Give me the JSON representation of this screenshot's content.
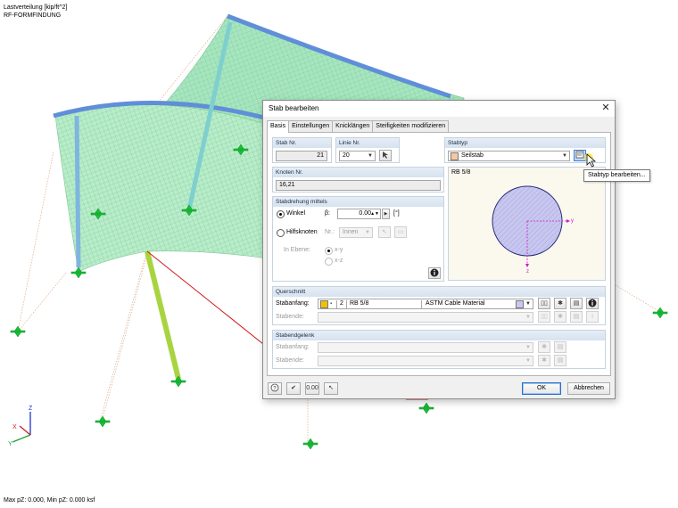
{
  "viewport": {
    "title_line1": "Lastverteilung [kip/ft^2]",
    "title_line2": "RF-FORMFINDUNG",
    "status": "Max pZ: 0.000, Min pZ: 0.000 ksf",
    "axis_z": "Z",
    "axis_x": "X",
    "axis_y": "Y"
  },
  "dialog": {
    "title": "Stab bearbeiten",
    "close_glyph": "✕",
    "tabs": [
      "Basis",
      "Einstellungen",
      "Knicklängen",
      "Steifigkeiten modifizieren"
    ],
    "stab_nr": {
      "label": "Stab Nr.",
      "value": "21"
    },
    "linie_nr": {
      "label": "Linie Nr.",
      "value": "20"
    },
    "stabtyp": {
      "label": "Stabtyp",
      "value": "Seilstab",
      "color": "#f6c8a0"
    },
    "knoten_nr": {
      "label": "Knoten Nr.",
      "value": "16,21"
    },
    "section_preview": {
      "label": "RB 5/8",
      "axis_y": "y",
      "axis_z": "z"
    },
    "stabdrehung": {
      "label": "Stabdrehung mittels",
      "winkel_label": "Winkel",
      "beta_label": "β:",
      "beta_value": "0.00",
      "beta_unit": "[°]",
      "hilfsknoten_label": "Hilfsknoten",
      "nr_label": "Nr.:",
      "innen_value": "Innen",
      "in_ebene_label": "In Ebene:",
      "xy_label": "x-y",
      "xz_label": "x-z"
    },
    "querschnitt": {
      "label": "Querschnitt",
      "stabanfang_label": "Stabanfang:",
      "stabende_label": "Stabende:",
      "color": "#f2c200",
      "number": "2",
      "name": "RB 5/8",
      "material": "ASTM Cable Material",
      "material_color": "#c8c8f0"
    },
    "stabendgelenk": {
      "label": "Stabendgelenk",
      "stabanfang_label": "Stabanfang:",
      "stabende_label": "Stabende:"
    },
    "ok_label": "OK",
    "cancel_label": "Abbrechen"
  },
  "tooltip": "Stabtyp bearbeiten..."
}
